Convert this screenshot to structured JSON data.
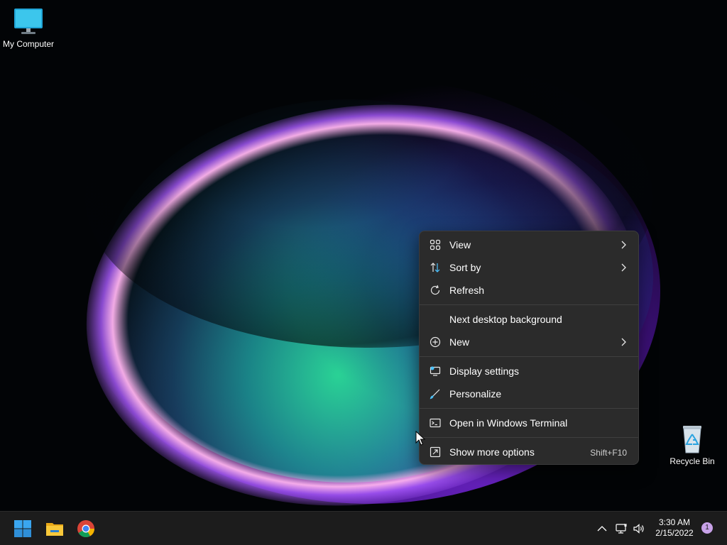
{
  "desktop": {
    "icons": [
      {
        "label": "My Computer",
        "icon": "monitor-icon"
      },
      {
        "label": "Recycle Bin",
        "icon": "recycle-bin-icon"
      }
    ]
  },
  "context_menu": {
    "items": [
      {
        "label": "View",
        "icon": "grid-icon",
        "has_submenu": true
      },
      {
        "label": "Sort by",
        "icon": "sort-arrows-icon",
        "has_submenu": true
      },
      {
        "label": "Refresh",
        "icon": "refresh-icon"
      },
      {
        "label": "Next desktop background"
      },
      {
        "label": "New",
        "icon": "plus-circle-icon",
        "has_submenu": true
      },
      {
        "label": "Display settings",
        "icon": "display-settings-icon"
      },
      {
        "label": "Personalize",
        "icon": "brush-icon"
      },
      {
        "label": "Open in Windows Terminal",
        "icon": "terminal-icon"
      },
      {
        "label": "Show more options",
        "icon": "more-options-icon",
        "shortcut": "Shift+F10"
      }
    ]
  },
  "taskbar": {
    "apps": [
      {
        "name": "Start",
        "icon": "windows-start-icon"
      },
      {
        "name": "File Explorer",
        "icon": "folder-icon"
      },
      {
        "name": "Google Chrome",
        "icon": "chrome-icon"
      }
    ],
    "tray": {
      "time": "3:30 AM",
      "date": "2/15/2022",
      "notification_count": "1"
    }
  },
  "colors": {
    "menu_bg": "#2b2b2b",
    "taskbar_bg": "#1c1c1c",
    "accent": "#4cc2ff"
  }
}
